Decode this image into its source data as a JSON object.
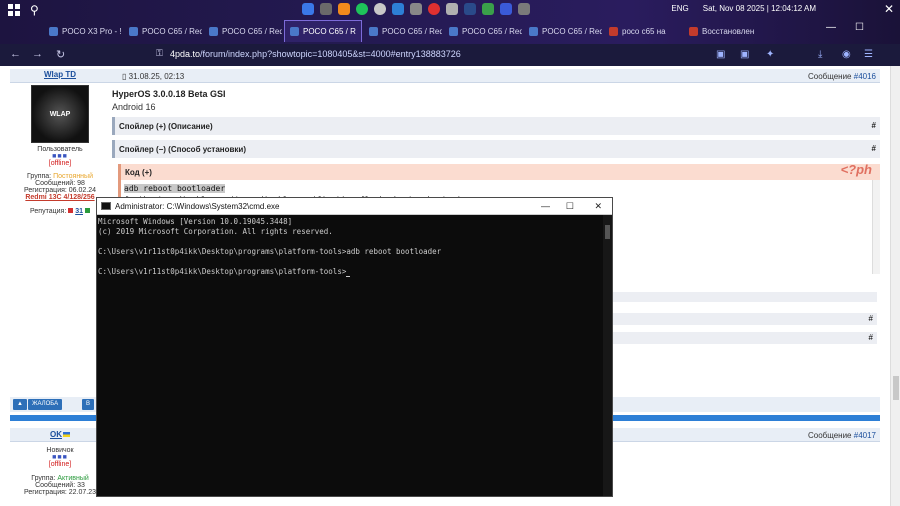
{
  "taskbar": {
    "tabs": [
      {
        "label": "POCO X3 Pro - !",
        "active": false
      },
      {
        "label": "POCO C65 / Red",
        "active": false
      },
      {
        "label": "POCO C65 / Red",
        "active": false
      },
      {
        "label": "POCO C65 / R",
        "active": true
      },
      {
        "label": "POCO C65 / Red",
        "active": false
      },
      {
        "label": "POCO C65 / Red",
        "active": false
      },
      {
        "label": "POCO C65 / Red",
        "active": false
      },
      {
        "label": "poco c65 на",
        "active": false
      },
      {
        "label": "Восстановлен",
        "active": false
      }
    ],
    "lang": "ENG",
    "datetime": "Sat, Nov 08 2025 | 12:04:12 AM"
  },
  "addressbar": {
    "url_domain": "4pda.to",
    "url_path": "/forum/index.php?showtopic=1080405&st=4000#entry138883726"
  },
  "post1": {
    "username": "Wlap TD",
    "date": "31.08.25, 02:13",
    "message_label": "Сообщение",
    "message_no": "#4016",
    "avatar_text": "WLAP",
    "role": "Пользователь",
    "status": "[offline]",
    "group_label": "Группа:",
    "group_value": "Постоянный",
    "posts": "Сообщений: 98",
    "registered": "Регистрация: 06.02.24",
    "device": "Redmi 13C 4/128/256",
    "rep_label": "Репутация:",
    "rep_value": "31",
    "title": "HyperOS 3.0.0.18 Beta GSI",
    "subtitle": "Android 16",
    "spoiler1": "Спойлер (+) (Описание)",
    "spoiler2": "Спойлер (−) (Способ установки)",
    "code_head": "Код (+)",
    "code_line1": "adb reboot bootloader",
    "code_line2": "fastboot --disable-verity --disable-verification flash vbmeta vbmeta.img",
    "hash": "#"
  },
  "actions": {
    "complain": "ЖАЛОБА",
    "other": "B"
  },
  "post2": {
    "username": "OK",
    "message_label": "Сообщение",
    "message_no": "#4017",
    "role": "Новичок",
    "status": "[offline]",
    "group_label": "Группа:",
    "group_value": "Активный",
    "posts": "Сообщений: 33",
    "registered": "Регистрация: 22.07.23"
  },
  "cmd": {
    "title": "Administrator: C:\\Windows\\System32\\cmd.exe",
    "line1": "Microsoft Windows [Version 10.0.19045.3448]",
    "line2": "(c) 2019 Microsoft Corporation. All rights reserved.",
    "line3": "C:\\Users\\v1r11st0p4ikk\\Desktop\\programs\\platform-tools>adb reboot bootloader",
    "line4": "C:\\Users\\v1r11st0p4ikk\\Desktop\\programs\\platform-tools>"
  }
}
